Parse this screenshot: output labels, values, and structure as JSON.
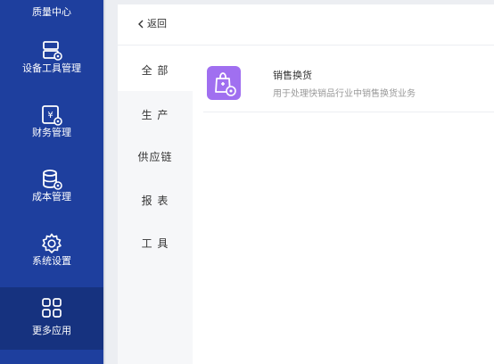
{
  "sidebar": {
    "top_label": "质量中心",
    "items": [
      {
        "label": "设备工具管理",
        "icon": "device-tool-icon"
      },
      {
        "label": "财务管理",
        "icon": "finance-icon"
      },
      {
        "label": "成本管理",
        "icon": "cost-database-icon"
      },
      {
        "label": "系统设置",
        "icon": "settings-gear-icon"
      },
      {
        "label": "更多应用",
        "icon": "grid-apps-icon"
      }
    ]
  },
  "back": {
    "label": "返回"
  },
  "categories": [
    "全 部",
    "生 产",
    "供应链",
    "报 表",
    "工 具"
  ],
  "apps": [
    {
      "title": "销售换货",
      "description": "用于处理快销品行业中销售换货业务",
      "icon": "shopping-bag-icon"
    }
  ],
  "colors": {
    "sidebar_bg": "#1e3f9e",
    "sidebar_active": "#16327f",
    "app_icon_bg": "#a06ff0"
  }
}
